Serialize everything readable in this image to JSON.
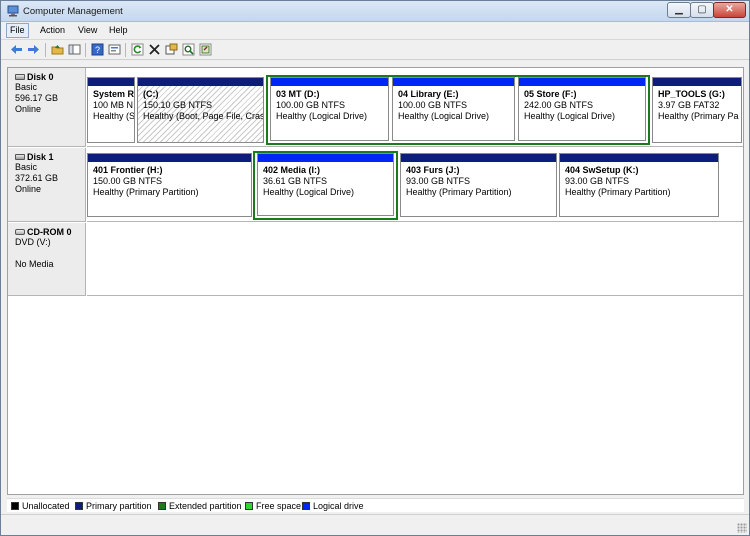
{
  "window": {
    "title": "Computer Management"
  },
  "menu": [
    "File",
    "Action",
    "View",
    "Help"
  ],
  "toolbar": {
    "buttons": [
      "back-arrow-icon",
      "forward-arrow-icon",
      "up-folder-icon",
      "show-hide-tree-icon",
      "help-icon",
      "properties-icon",
      "refresh-icon",
      "delete-icon",
      "settings-icon",
      "search-icon",
      "export-icon"
    ]
  },
  "disks": [
    {
      "name": "Disk 0",
      "type": "Basic",
      "size": "596.17 GB",
      "status": "Online",
      "partitions": [
        {
          "name": "System R",
          "size": "100 MB N",
          "status": "Healthy (S"
        },
        {
          "name": "(C:)",
          "size": "150.10 GB NTFS",
          "status": "Healthy (Boot, Page File, Cras"
        },
        {
          "name": "03 MT  (D:)",
          "size": "100.00 GB NTFS",
          "status": "Healthy (Logical Drive)"
        },
        {
          "name": "04 Library  (E:)",
          "size": "100.00 GB NTFS",
          "status": "Healthy (Logical Drive)"
        },
        {
          "name": "05 Store  (F:)",
          "size": "242.00 GB NTFS",
          "status": "Healthy (Logical Drive)"
        },
        {
          "name": "HP_TOOLS  (G:)",
          "size": "3.97 GB FAT32",
          "status": "Healthy (Primary Pa"
        }
      ]
    },
    {
      "name": "Disk 1",
      "type": "Basic",
      "size": "372.61 GB",
      "status": "Online",
      "partitions": [
        {
          "name": "401 Frontier  (H:)",
          "size": "150.00 GB NTFS",
          "status": "Healthy (Primary Partition)"
        },
        {
          "name": "402 Media  (I:)",
          "size": "36.61 GB NTFS",
          "status": "Healthy (Logical Drive)"
        },
        {
          "name": "403 Furs  (J:)",
          "size": "93.00 GB NTFS",
          "status": "Healthy (Primary Partition)"
        },
        {
          "name": "404 SwSetup  (K:)",
          "size": "93.00 GB NTFS",
          "status": "Healthy (Primary Partition)"
        }
      ]
    },
    {
      "name": "CD-ROM 0",
      "type": "DVD (V:)",
      "size": "",
      "status": "No Media",
      "partitions": []
    }
  ],
  "legend": [
    {
      "label": "Unallocated",
      "color": "#000000"
    },
    {
      "label": "Primary partition",
      "color": "#0c1d7a"
    },
    {
      "label": "Extended partition",
      "color": "#1b7a1b"
    },
    {
      "label": "Free space",
      "color": "#2fd72f"
    },
    {
      "label": "Logical drive",
      "color": "#0026f5"
    }
  ],
  "colors": {
    "primary": "#0c1d7a",
    "logical": "#0026f5",
    "extended": "#1b7a1b"
  }
}
